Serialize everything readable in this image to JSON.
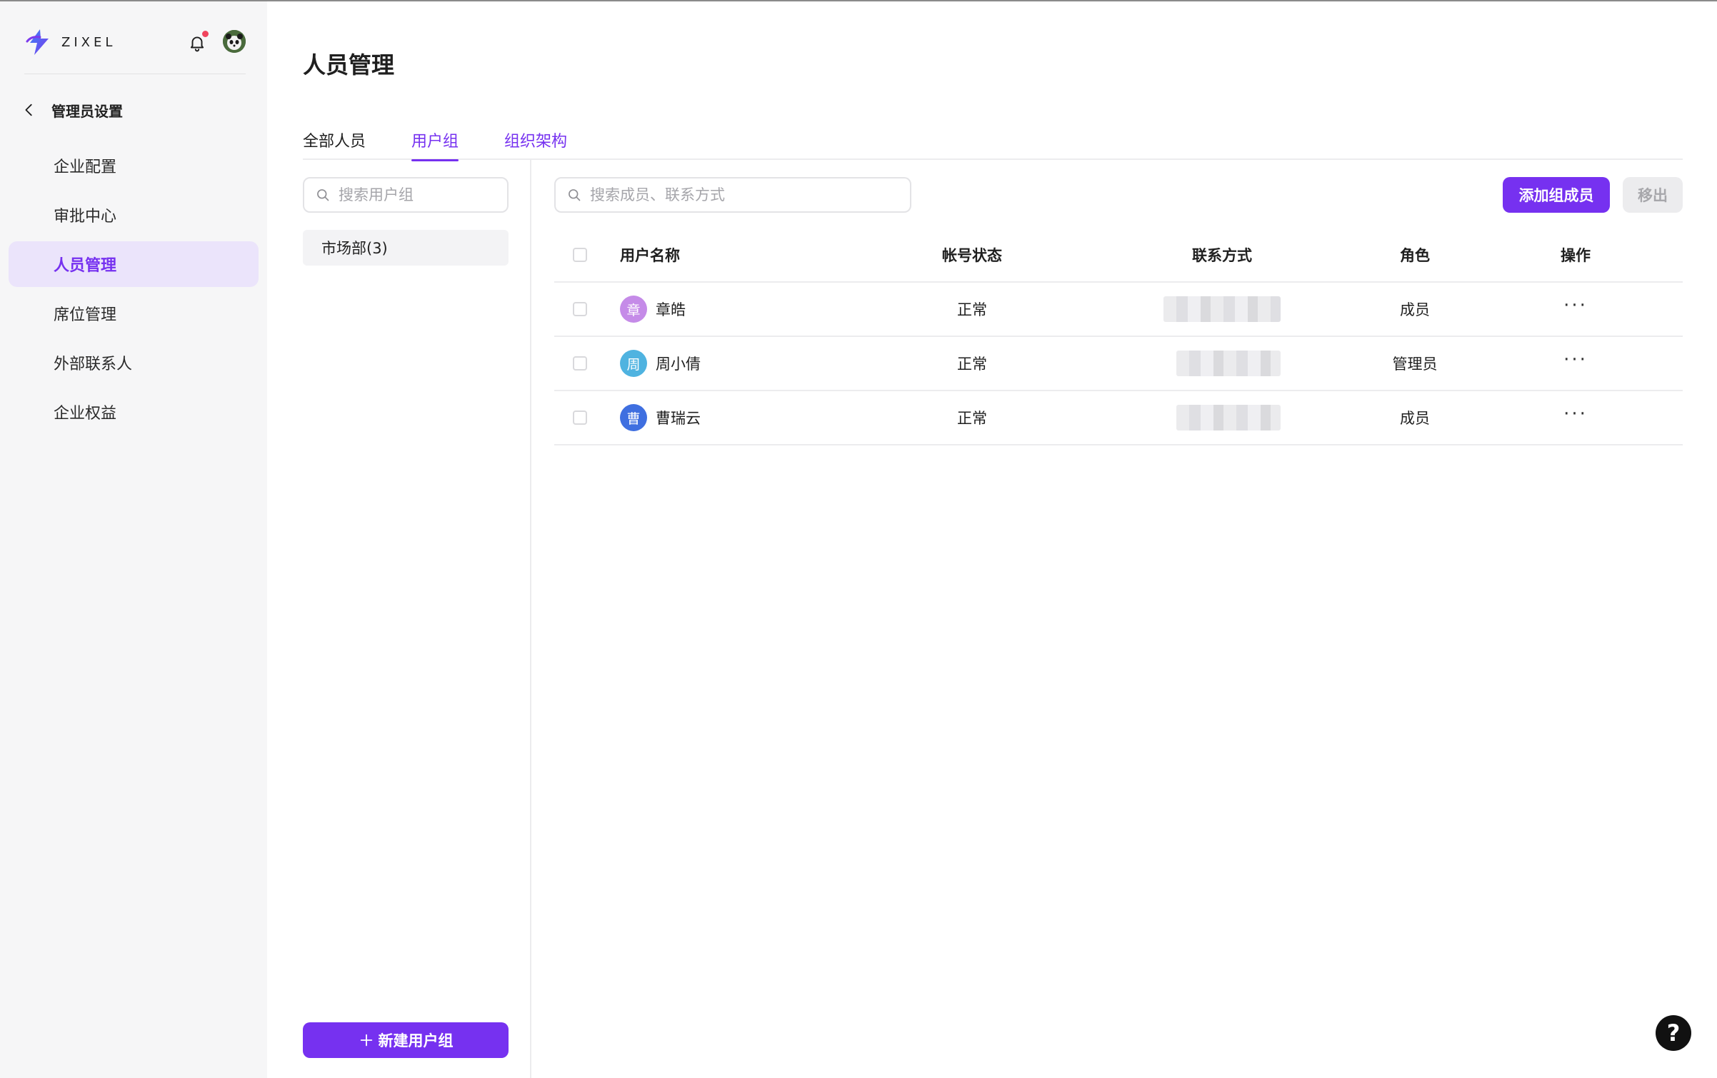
{
  "brand": {
    "name": "ZIXEL"
  },
  "sidebar": {
    "back_label": "管理员设置",
    "items": [
      {
        "label": "企业配置",
        "active": false
      },
      {
        "label": "审批中心",
        "active": false
      },
      {
        "label": "人员管理",
        "active": true
      },
      {
        "label": "席位管理",
        "active": false
      },
      {
        "label": "外部联系人",
        "active": false
      },
      {
        "label": "企业权益",
        "active": false
      }
    ]
  },
  "main": {
    "title": "人员管理",
    "tabs": [
      {
        "label": "全部人员",
        "active": false
      },
      {
        "label": "用户组",
        "active": true
      },
      {
        "label": "组织架构",
        "active": false
      }
    ]
  },
  "groups": {
    "search_placeholder": "搜索用户组",
    "items": [
      {
        "label": "市场部(3)",
        "selected": true
      }
    ],
    "new_button_label": "新建用户组"
  },
  "members": {
    "search_placeholder": "搜索成员、联系方式",
    "add_button_label": "添加组成员",
    "remove_button_label": "移出",
    "columns": {
      "name": "用户名称",
      "status": "帐号状态",
      "contact": "联系方式",
      "role": "角色",
      "op": "操作"
    },
    "rows": [
      {
        "avatar_char": "章",
        "avatar_color": "#c58be8",
        "name": "章皓",
        "status": "正常",
        "role": "成员",
        "op": "···"
      },
      {
        "avatar_char": "周",
        "avatar_color": "#4fb3e0",
        "name": "周小倩",
        "status": "正常",
        "role": "管理员",
        "op": "···"
      },
      {
        "avatar_char": "曹",
        "avatar_color": "#3f6fe0",
        "name": "曹瑞云",
        "status": "正常",
        "role": "成员",
        "op": "···"
      }
    ]
  },
  "help": {
    "label": "?"
  },
  "colors": {
    "accent": "#7631f0",
    "active_bg": "#ebe4fb",
    "notification_dot": "#f0445d"
  }
}
